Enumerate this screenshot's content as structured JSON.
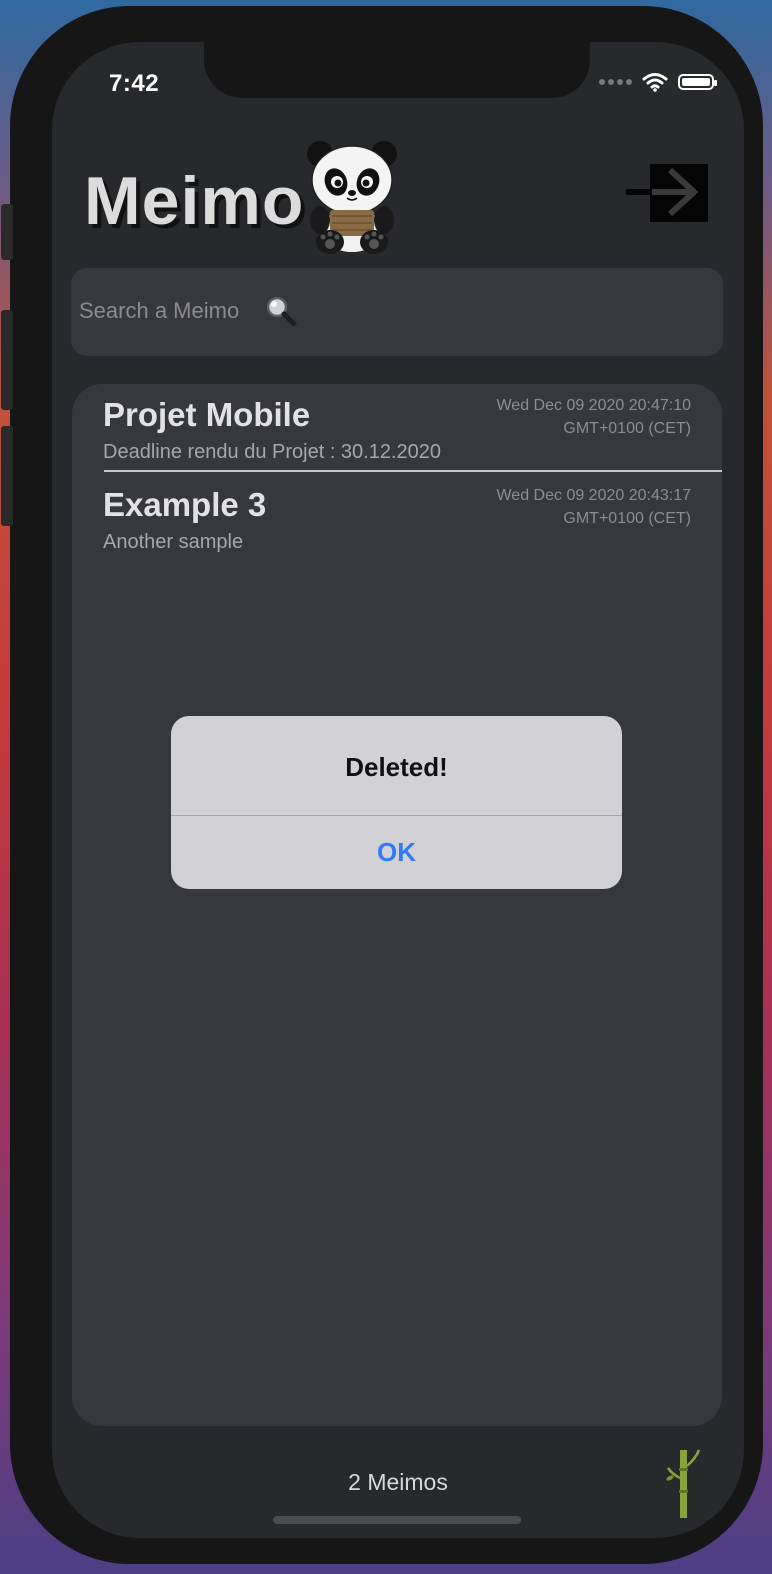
{
  "status_bar": {
    "time": "7:42"
  },
  "header": {
    "app_title": "Meimo",
    "logo_icon": "panda-icon",
    "logout_icon": "sign-in-arrow-icon"
  },
  "search": {
    "placeholder": "Search a Meimo",
    "value": "",
    "icon": "magnifying-glass-icon"
  },
  "memos": [
    {
      "title": "Projet Mobile",
      "subtitle": "Deadline rendu du Projet : 30.12.2020",
      "date_line1": "Wed Dec 09 2020 20:47:10",
      "date_line2": "GMT+0100 (CET)"
    },
    {
      "title": "Example 3",
      "subtitle": "Another sample",
      "date_line1": "Wed Dec 09 2020 20:43:17",
      "date_line2": "GMT+0100 (CET)"
    }
  ],
  "alert": {
    "title": "Deleted!",
    "ok_label": "OK"
  },
  "footer": {
    "count_label": "2 Meimos",
    "icon": "bamboo-icon"
  },
  "colors": {
    "background": "#28292c",
    "card": "#36383e",
    "alert_bg": "#d2d1d6",
    "alert_button": "#2f7cf6"
  }
}
